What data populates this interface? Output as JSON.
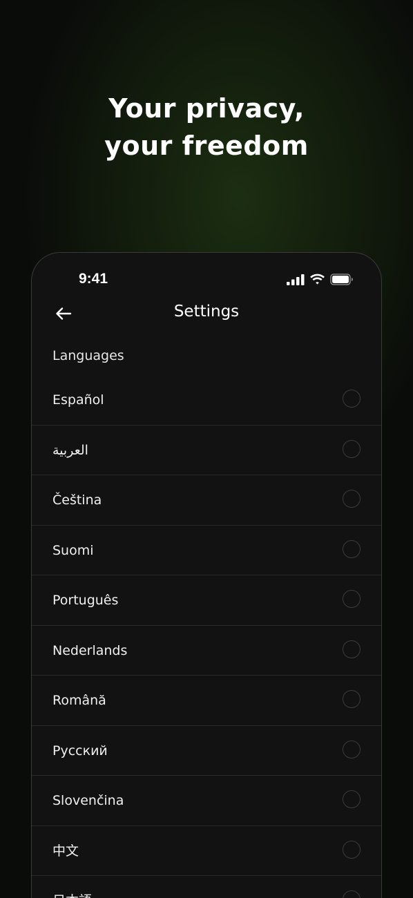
{
  "headline": {
    "line1": "Your privacy,",
    "line2": "your freedom"
  },
  "status_bar": {
    "time": "9:41",
    "icons": [
      "signal-icon",
      "wifi-icon",
      "battery-icon"
    ]
  },
  "nav": {
    "back_icon": "arrow-left-icon",
    "title": "Settings"
  },
  "section": {
    "label": "Languages"
  },
  "languages": [
    {
      "label": "Español"
    },
    {
      "label": "العربية"
    },
    {
      "label": "Čeština"
    },
    {
      "label": "Suomi"
    },
    {
      "label": "Português"
    },
    {
      "label": "Nederlands"
    },
    {
      "label": "Română"
    },
    {
      "label": "Русский"
    },
    {
      "label": "Slovenčina"
    },
    {
      "label": "中文"
    },
    {
      "label": "日本語"
    }
  ],
  "colors": {
    "background": "#0a0c09",
    "accent_glow": "#1c2e12",
    "phone_bg": "#121212",
    "divider": "#2a2a2a",
    "radio_border": "#3c3c3c"
  }
}
